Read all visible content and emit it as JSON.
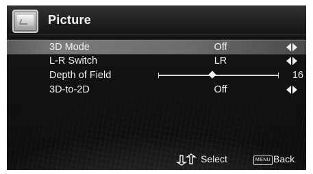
{
  "menu": {
    "title": "Picture",
    "items": [
      {
        "label": "3D Mode",
        "value": "Off",
        "selected": true,
        "has_arrows": true
      },
      {
        "label": "L-R Switch",
        "value": "LR",
        "selected": false,
        "has_arrows": true
      },
      {
        "label": "Depth of Field",
        "value_number": "16",
        "slider": {
          "value_fraction": 0.45
        },
        "selected": false,
        "has_arrows": false
      },
      {
        "label": "3D-to-2D",
        "value": "Off",
        "selected": false,
        "has_arrows": true
      }
    ]
  },
  "footer": {
    "select_label": "Select",
    "menu_key_label": "MENU",
    "back_label": "Back"
  },
  "icons": {
    "header": "picture-icon",
    "arrows": "left-right-arrows-icon",
    "nav": "up-down-arrows-icon"
  }
}
